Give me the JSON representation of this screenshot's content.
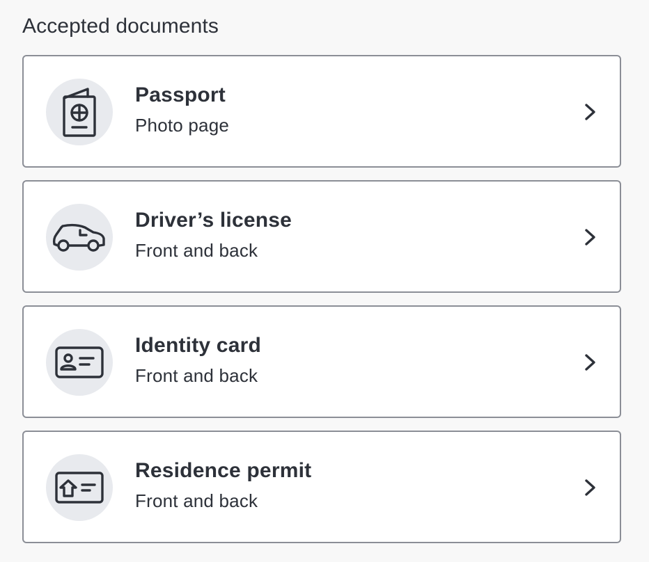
{
  "section_title": "Accepted documents",
  "documents": [
    {
      "title": "Passport",
      "subtitle": "Photo page",
      "icon": "passport-icon"
    },
    {
      "title": "Driver’s license",
      "subtitle": "Front and back",
      "icon": "car-icon"
    },
    {
      "title": "Identity card",
      "subtitle": "Front and back",
      "icon": "id-card-icon"
    },
    {
      "title": "Residence permit",
      "subtitle": "Front and back",
      "icon": "residence-permit-icon"
    }
  ],
  "colors": {
    "background": "#f8f8f8",
    "card": "#ffffff",
    "border": "#8b8e96",
    "icon_circle": "#e8eaee",
    "text": "#2d3139"
  }
}
